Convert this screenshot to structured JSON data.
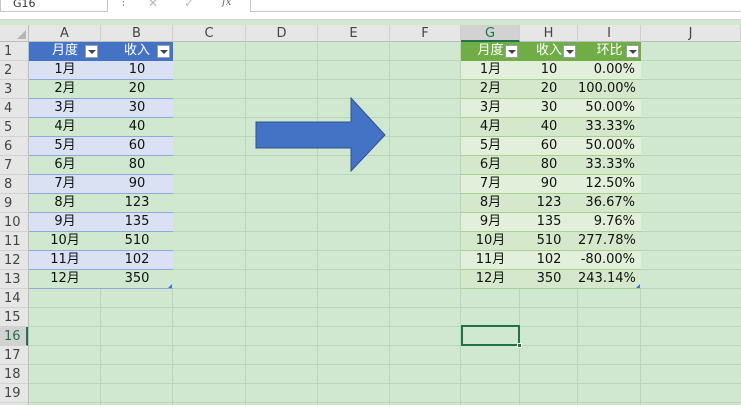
{
  "formula_bar": {
    "name_box": "G16",
    "cancel_icon": "x-icon",
    "enter_icon": "check-icon",
    "fx_label": "fx",
    "formula": ""
  },
  "columns": [
    "A",
    "B",
    "C",
    "D",
    "E",
    "F",
    "G",
    "H",
    "I",
    "J"
  ],
  "selected_column": "G",
  "rows": [
    "1",
    "2",
    "3",
    "4",
    "5",
    "6",
    "7",
    "8",
    "9",
    "10",
    "11",
    "12",
    "13",
    "14",
    "15",
    "16",
    "17",
    "18",
    "19"
  ],
  "selected_row": "16",
  "selected_cell": "G16",
  "left_table": {
    "headers": [
      "月度",
      "收入"
    ],
    "rows": [
      [
        "1月",
        "10"
      ],
      [
        "2月",
        "20"
      ],
      [
        "3月",
        "30"
      ],
      [
        "4月",
        "40"
      ],
      [
        "5月",
        "60"
      ],
      [
        "6月",
        "80"
      ],
      [
        "7月",
        "90"
      ],
      [
        "8月",
        "123"
      ],
      [
        "9月",
        "135"
      ],
      [
        "10月",
        "510"
      ],
      [
        "11月",
        "102"
      ],
      [
        "12月",
        "350"
      ]
    ]
  },
  "right_table": {
    "headers": [
      "月度",
      "收入",
      "环比"
    ],
    "rows": [
      [
        "1月",
        "10",
        "0.00%"
      ],
      [
        "2月",
        "20",
        "100.00%"
      ],
      [
        "3月",
        "30",
        "50.00%"
      ],
      [
        "4月",
        "40",
        "33.33%"
      ],
      [
        "5月",
        "60",
        "50.00%"
      ],
      [
        "6月",
        "80",
        "33.33%"
      ],
      [
        "7月",
        "90",
        "12.50%"
      ],
      [
        "8月",
        "123",
        "36.67%"
      ],
      [
        "9月",
        "135",
        "9.76%"
      ],
      [
        "10月",
        "510",
        "277.78%"
      ],
      [
        "11月",
        "102",
        "-80.00%"
      ],
      [
        "12月",
        "350",
        "243.14%"
      ]
    ]
  },
  "arrow_shape": {
    "color": "#4472c4",
    "direction": "right"
  },
  "colors": {
    "sheet_bg": "#cfe8cf",
    "left_header": "#4472c4",
    "left_band": "#d9e1f2",
    "right_header": "#70ad47",
    "right_band": "#e2efda",
    "selection": "#217346"
  }
}
